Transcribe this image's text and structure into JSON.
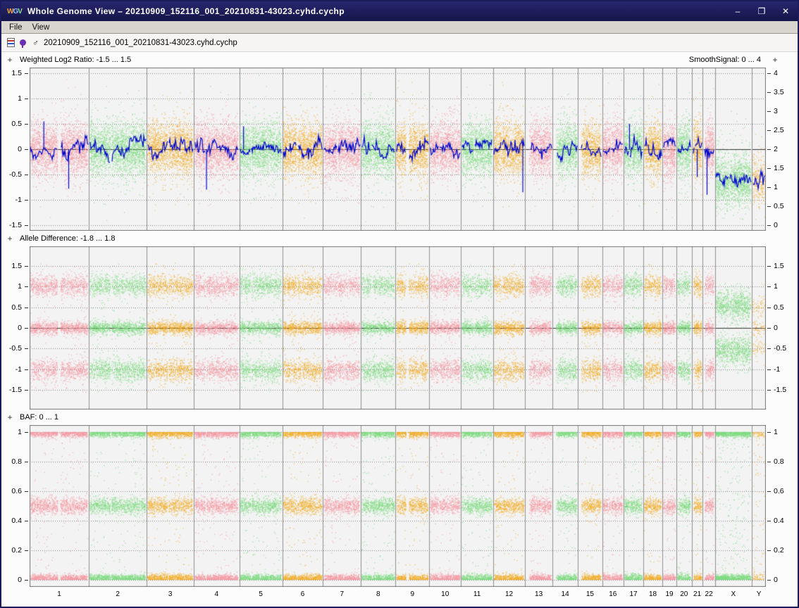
{
  "window": {
    "title": "Whole Genome View – 20210909_152116_001_20210831-43023.cyhd.cychp",
    "logo_letters": [
      "W",
      "G",
      "V"
    ],
    "controls": {
      "minimize": "–",
      "maximize": "❐",
      "close": "✕"
    }
  },
  "menu": {
    "items": [
      "File",
      "View"
    ]
  },
  "toolbar": {
    "sex_symbol": "♂",
    "sample_name": "20210909_152116_001_20210831-43023.cyhd.cychp"
  },
  "chromosomes": {
    "labels": [
      "1",
      "2",
      "3",
      "4",
      "5",
      "6",
      "7",
      "8",
      "9",
      "10",
      "11",
      "12",
      "13",
      "14",
      "15",
      "16",
      "17",
      "18",
      "19",
      "20",
      "21",
      "22",
      "X",
      "Y"
    ],
    "sizes_mb": [
      249,
      243,
      198,
      191,
      181,
      171,
      159,
      146,
      141,
      134,
      135,
      134,
      115,
      107,
      102,
      90,
      83,
      80,
      59,
      64,
      47,
      51,
      155,
      59
    ],
    "centromere_fraction": [
      0.5,
      0.38,
      0.46,
      0.26,
      0.27,
      0.36,
      0.38,
      0.31,
      0.35,
      0.3,
      0.4,
      0.27,
      0.17,
      0.17,
      0.19,
      0.41,
      0.29,
      0.23,
      0.47,
      0.44,
      0.27,
      0.29,
      0.39,
      0.21
    ],
    "acrocentric": [
      "13",
      "14",
      "15",
      "21",
      "22"
    ]
  },
  "panels": [
    {
      "expander": "+",
      "title": "Weighted Log2 Ratio: -1.5 ... 1.5",
      "right_title": "SmoothSignal: 0 ... 4",
      "right_expander": "+",
      "left_ticks": [
        {
          "v": 1.5,
          "t": "1.5"
        },
        {
          "v": 1,
          "t": "1"
        },
        {
          "v": 0.5,
          "t": "0.5"
        },
        {
          "v": 0,
          "t": "0"
        },
        {
          "v": -0.5,
          "t": "-0.5"
        },
        {
          "v": -1,
          "t": "-1"
        },
        {
          "v": -1.5,
          "t": "-1.5"
        }
      ],
      "right_ticks": [
        {
          "v": 4,
          "t": "4"
        },
        {
          "v": 3.5,
          "t": "3.5"
        },
        {
          "v": 3,
          "t": "3"
        },
        {
          "v": 2.5,
          "t": "2.5"
        },
        {
          "v": 2,
          "t": "2"
        },
        {
          "v": 1.5,
          "t": "1.5"
        },
        {
          "v": 1,
          "t": "1"
        },
        {
          "v": 0.5,
          "t": "0.5"
        },
        {
          "v": 0,
          "t": "0"
        }
      ]
    },
    {
      "expander": "+",
      "title": "Allele Difference: -1.8 ... 1.8",
      "left_ticks": [
        {
          "v": 1.5,
          "t": "1.5"
        },
        {
          "v": 1,
          "t": "1"
        },
        {
          "v": 0.5,
          "t": "0.5"
        },
        {
          "v": 0,
          "t": "0"
        },
        {
          "v": -0.5,
          "t": "-0.5"
        },
        {
          "v": -1,
          "t": "-1"
        },
        {
          "v": -1.5,
          "t": "-1.5"
        }
      ],
      "right_ticks": [
        {
          "v": 1.5,
          "t": "1.5"
        },
        {
          "v": 1,
          "t": "1"
        },
        {
          "v": 0.5,
          "t": "0.5"
        },
        {
          "v": 0,
          "t": "0"
        },
        {
          "v": -0.5,
          "t": "-0.5"
        },
        {
          "v": -1,
          "t": "-1"
        },
        {
          "v": -1.5,
          "t": "-1.5"
        }
      ]
    },
    {
      "expander": "+",
      "title": "BAF: 0 ... 1",
      "left_ticks": [
        {
          "v": 1,
          "t": "1"
        },
        {
          "v": 0.8,
          "t": "0.8"
        },
        {
          "v": 0.6,
          "t": "0.6"
        },
        {
          "v": 0.4,
          "t": "0.4"
        },
        {
          "v": 0.2,
          "t": "0.2"
        },
        {
          "v": 0,
          "t": "0"
        }
      ],
      "right_ticks": [
        {
          "v": 1,
          "t": "1"
        },
        {
          "v": 0.8,
          "t": "0.8"
        },
        {
          "v": 0.6,
          "t": "0.6"
        },
        {
          "v": 0.4,
          "t": "0.4"
        },
        {
          "v": 0.2,
          "t": "0.2"
        },
        {
          "v": 0,
          "t": "0"
        }
      ]
    }
  ],
  "colors": {
    "cycle": [
      "#f699a3",
      "#7edc80",
      "#f2ae2a"
    ],
    "smooth_signal": "#0008cc",
    "titlebar": "#1c1c5c",
    "plot_bg": "#f3f3f4",
    "grid": "#8a8a8a"
  },
  "chart_data": [
    {
      "type": "scatter",
      "title": "Weighted Log2 Ratio",
      "ylim": [
        -1.5,
        1.5
      ],
      "yticks": [
        1.5,
        1,
        0.5,
        0,
        -0.5,
        -1,
        -1.5
      ],
      "right_axis": {
        "label": "SmoothSignal",
        "ylim": [
          0,
          4
        ],
        "yticks": [
          4,
          3.5,
          3,
          2.5,
          2,
          1.5,
          1,
          0.5,
          0
        ]
      },
      "x_categories": [
        "1",
        "2",
        "3",
        "4",
        "5",
        "6",
        "7",
        "8",
        "9",
        "10",
        "11",
        "12",
        "13",
        "14",
        "15",
        "16",
        "17",
        "18",
        "19",
        "20",
        "21",
        "22",
        "X",
        "Y"
      ],
      "centers": {
        "autosomes": 0,
        "X": -0.62,
        "Y": -0.6,
        "Y_smooth": -0.75
      },
      "smooth_signal_copy_number": {
        "autosomes": 2,
        "X": 1,
        "Y": 1
      },
      "spikes": [
        [
          0,
          0.24,
          0.55
        ],
        [
          0,
          0.66,
          -0.78
        ],
        [
          3,
          0.28,
          -0.8
        ],
        [
          4,
          0.1,
          0.45
        ],
        [
          11,
          0.93,
          -0.85
        ],
        [
          16,
          0.3,
          0.5
        ],
        [
          20,
          0.5,
          -0.55
        ],
        [
          21,
          0.35,
          -0.9
        ]
      ],
      "legend": "points colored per chromosome in pink/green/orange cycle; blue trace = smooth signal at copy number 2 for autosomes, 1 for X and Y (male sample)"
    },
    {
      "type": "scatter",
      "title": "Allele Difference",
      "ylim": [
        -1.8,
        1.8
      ],
      "yticks": [
        1.5,
        1,
        0.5,
        0,
        -0.5,
        -1,
        -1.5
      ],
      "x_categories": [
        "1",
        "2",
        "3",
        "4",
        "5",
        "6",
        "7",
        "8",
        "9",
        "10",
        "11",
        "12",
        "13",
        "14",
        "15",
        "16",
        "17",
        "18",
        "19",
        "20",
        "21",
        "22",
        "X",
        "Y"
      ],
      "bands": {
        "autosomes": [
          1,
          0,
          -1
        ],
        "X": [
          0.55,
          -0.55
        ],
        "Y": [
          0.5,
          0,
          -0.5
        ]
      }
    },
    {
      "type": "scatter",
      "title": "BAF",
      "ylim": [
        0,
        1
      ],
      "yticks": [
        1,
        0.8,
        0.6,
        0.4,
        0.2,
        0
      ],
      "x_categories": [
        "1",
        "2",
        "3",
        "4",
        "5",
        "6",
        "7",
        "8",
        "9",
        "10",
        "11",
        "12",
        "13",
        "14",
        "15",
        "16",
        "17",
        "18",
        "19",
        "20",
        "21",
        "22",
        "X",
        "Y"
      ],
      "bands": {
        "autosomes": [
          1,
          0.5,
          0
        ],
        "X": [
          1,
          0
        ],
        "Y": [
          1,
          0
        ]
      }
    }
  ]
}
